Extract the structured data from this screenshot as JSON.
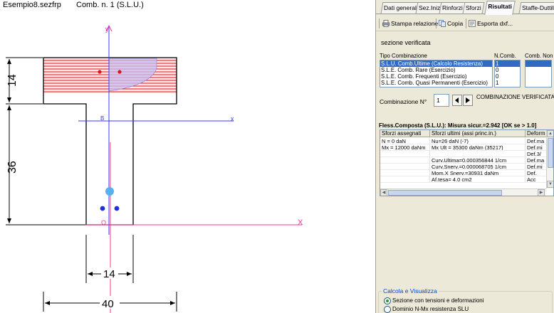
{
  "drawing": {
    "file_name": "Esempio8.sezfrp",
    "combination_caption": "Comb. n. 1 (S.L.U.)",
    "dimensions": {
      "flange_height": "14",
      "web_height": "36",
      "web_width": "14",
      "total_width": "40"
    },
    "axis_labels": {
      "y_axis": "y",
      "x_axis": "x",
      "centroid": "B",
      "x_axis_bottom": "X",
      "origin": "O"
    },
    "colors": {
      "section_outline": "#000000",
      "compressed_zone": "#e0141e",
      "stress_fill": "#b8a9f0",
      "vertical_axis": "#3a3aff",
      "neutral_axis": "#ff3399",
      "rebar": "#1f2fe0",
      "rebar_large": "#58b0f0"
    }
  },
  "panel": {
    "tabs": [
      {
        "label": "Dati generali",
        "active": false
      },
      {
        "label": "Sez.Iniz.",
        "active": false
      },
      {
        "label": "Rinforzi",
        "active": false
      },
      {
        "label": "Sforzi",
        "active": false
      },
      {
        "label": "Risultati",
        "active": true
      },
      {
        "label": "Staffe-Duttilit",
        "active": false
      }
    ],
    "toolbar": {
      "print_label": "Stampa relazione",
      "copy_label": "Copia",
      "export_label": "Esporta dxf..."
    },
    "status_text": "sezione verificata",
    "combinations": {
      "header_tipo": "Tipo  Combinazione",
      "header_ncomb": "N.Comb.",
      "header_comb_non": "Comb. Non",
      "rows": [
        {
          "label": "S.L.U. Comb.Ultime (Calcolo Resistenza)",
          "n": "1",
          "selected": true
        },
        {
          "label": "S.L.E. Comb. Rare (Esercizio)",
          "n": "0",
          "selected": false
        },
        {
          "label": "S.L.E. Comb. Frequenti (Esercizio)",
          "n": "0",
          "selected": false
        },
        {
          "label": "S.L.E. Comb. Quasi Permanenti (Esercizio)",
          "n": "1",
          "selected": false
        }
      ]
    },
    "combination_no": {
      "label": "Combinazione N°",
      "value": "1",
      "status": "COMBINAZIONE VERIFICATA"
    },
    "result_title": "Fless.Composta (S.L.U.): Misura sicur.=2.942 [OK se > 1.0]",
    "grid": {
      "headers": [
        "Sforzi assegnati",
        "Sforzi ultimi (assi princ.in.)",
        "Deform"
      ],
      "rows": [
        [
          "N  = 0 daN",
          "Nu=26 daN (-7)",
          "Def.ma"
        ],
        [
          "Mx  = 12000 daNm",
          "Mx Ult = 35300 daNm (35217)",
          "Def.mi"
        ],
        [
          "",
          "",
          "Def.3/"
        ],
        [
          "",
          "Curv.Ultima=0.000356844 1/cm",
          "Def.ma"
        ],
        [
          "",
          "Curv.Snerv.=0.000068705 1/cm",
          "Def.mi"
        ],
        [
          "",
          "Mom.X Snerv.=30931 daNm",
          "Def."
        ],
        [
          "",
          "Af.tesa= 4.0 cm2",
          "Acc"
        ]
      ]
    },
    "calc_group": {
      "title": "Calcola e Visualizza",
      "options": [
        {
          "label": "Sezione con tensioni e deformazioni",
          "checked": true
        },
        {
          "label": "Dominio N-Mx resistenza SLU",
          "checked": false
        }
      ]
    }
  }
}
